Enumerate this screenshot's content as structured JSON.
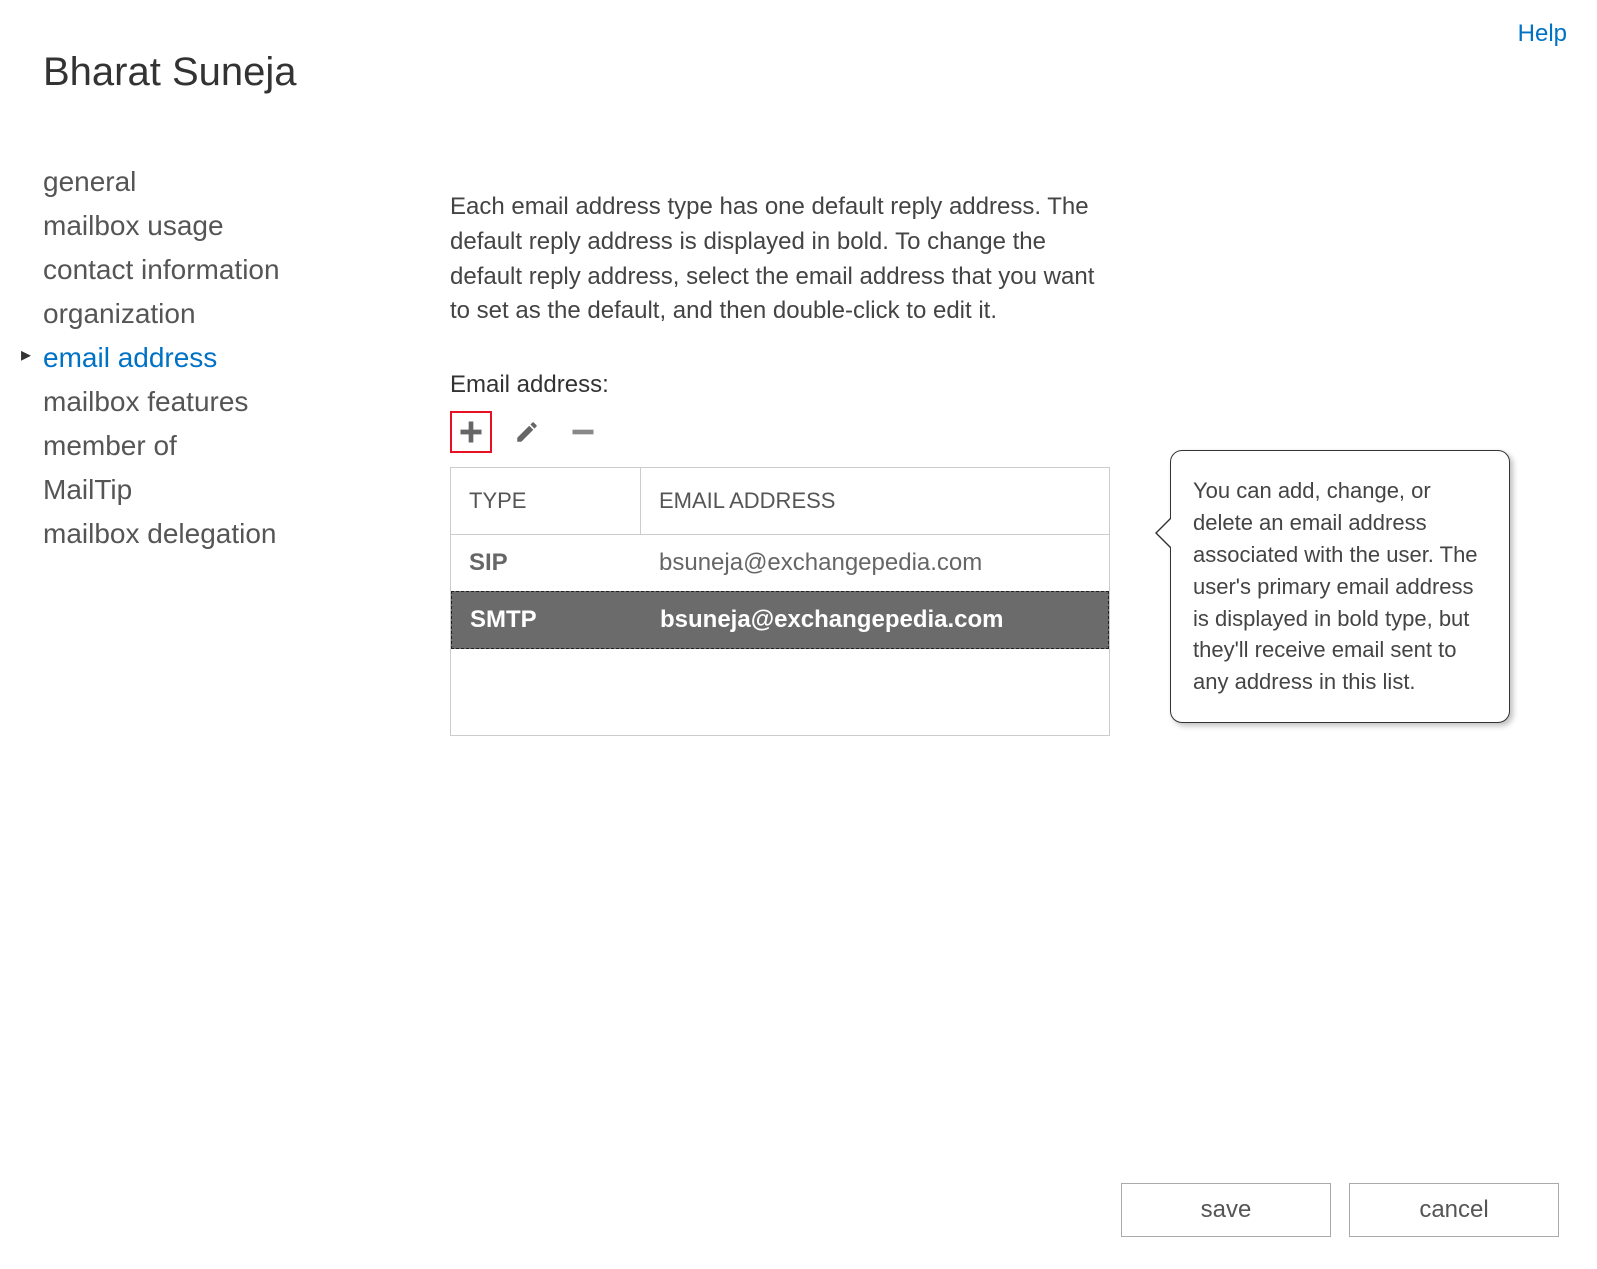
{
  "help_label": "Help",
  "page_title": "Bharat Suneja",
  "sidebar": {
    "items": [
      {
        "label": "general",
        "active": false
      },
      {
        "label": "mailbox usage",
        "active": false
      },
      {
        "label": "contact information",
        "active": false
      },
      {
        "label": "organization",
        "active": false
      },
      {
        "label": "email address",
        "active": true
      },
      {
        "label": "mailbox features",
        "active": false
      },
      {
        "label": "member of",
        "active": false
      },
      {
        "label": "MailTip",
        "active": false
      },
      {
        "label": "mailbox delegation",
        "active": false
      }
    ]
  },
  "main": {
    "description": "Each email address type has one default reply address. The default reply address is displayed in bold. To change the default reply address, select the email address that you want to set as the default, and then double-click to edit it.",
    "field_label": "Email address:",
    "columns": {
      "type": "TYPE",
      "email": "EMAIL ADDRESS"
    },
    "rows": [
      {
        "type": "SIP",
        "email": "bsuneja@exchangepedia.com",
        "selected": false
      },
      {
        "type": "SMTP",
        "email": "bsuneja@exchangepedia.com",
        "selected": true
      }
    ]
  },
  "callout": {
    "text": "You can add, change, or delete an email address associated with the user. The user's primary email address is displayed in bold type, but they'll receive email sent to any address in this list."
  },
  "footer": {
    "save": "save",
    "cancel": "cancel"
  }
}
